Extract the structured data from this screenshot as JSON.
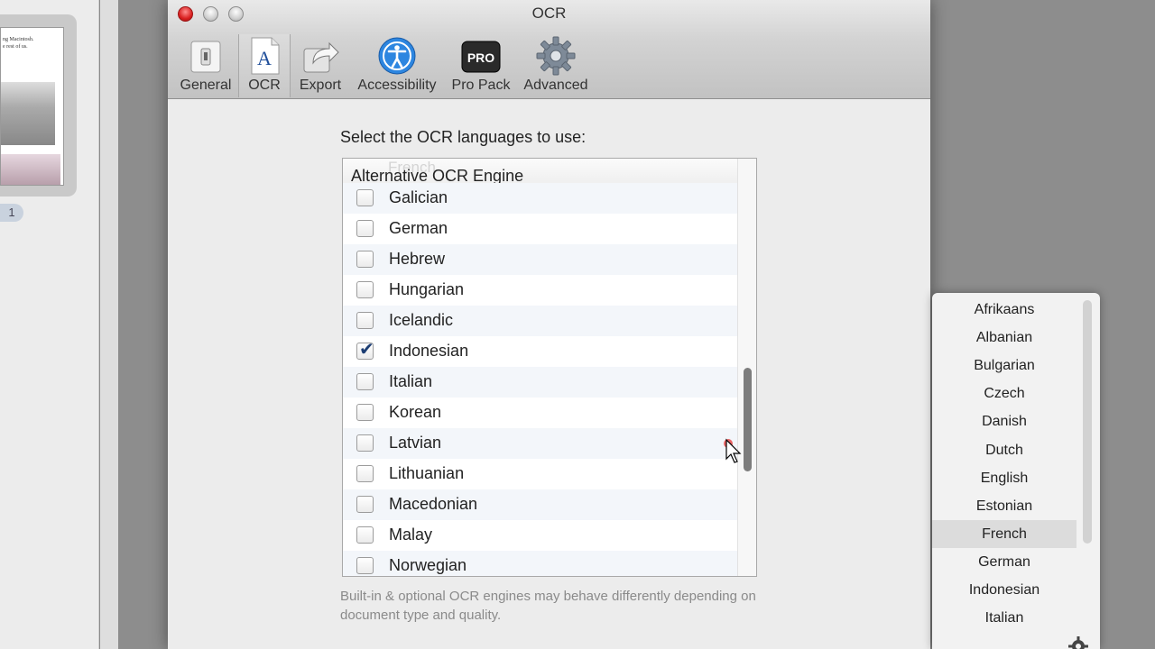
{
  "background_app": {
    "thumbnail_text": [
      "ng Macintosh.",
      "e rest of us."
    ],
    "page_number": "1"
  },
  "window": {
    "title": "OCR"
  },
  "toolbar": {
    "items": [
      {
        "label": "General",
        "icon": "switch-icon"
      },
      {
        "label": "OCR",
        "icon": "ocr-letter-icon",
        "selected": true
      },
      {
        "label": "Export",
        "icon": "export-arrow-icon"
      },
      {
        "label": "Accessibility",
        "icon": "accessibility-icon"
      },
      {
        "label": "Pro Pack",
        "icon": "pro-badge-icon",
        "badge": "PRO"
      },
      {
        "label": "Advanced",
        "icon": "gear-icon"
      }
    ]
  },
  "ocr": {
    "prompt": "Select the OCR languages to use:",
    "list_header": "Alternative OCR Engine",
    "list_header_ghost": "French",
    "languages": [
      {
        "name": "Galician",
        "checked": false
      },
      {
        "name": "German",
        "checked": false
      },
      {
        "name": "Hebrew",
        "checked": false
      },
      {
        "name": "Hungarian",
        "checked": false
      },
      {
        "name": "Icelandic",
        "checked": false
      },
      {
        "name": "Indonesian",
        "checked": true
      },
      {
        "name": "Italian",
        "checked": false
      },
      {
        "name": "Korean",
        "checked": false
      },
      {
        "name": "Latvian",
        "checked": false
      },
      {
        "name": "Lithuanian",
        "checked": false
      },
      {
        "name": "Macedonian",
        "checked": false
      },
      {
        "name": "Malay",
        "checked": false
      },
      {
        "name": "Norwegian",
        "checked": false
      }
    ],
    "footnote": "Built-in & optional OCR engines may behave differently depending on document type and quality."
  },
  "popup": {
    "items": [
      "Afrikaans",
      "Albanian",
      "Bulgarian",
      "Czech",
      "Danish",
      "Dutch",
      "English",
      "Estonian",
      "French",
      "German",
      "Indonesian",
      "Italian"
    ],
    "selected": "French"
  },
  "colors": {
    "selection_row": "#dcdcdc",
    "checkmark": "#1c3d73",
    "close_button": "#d92020"
  }
}
